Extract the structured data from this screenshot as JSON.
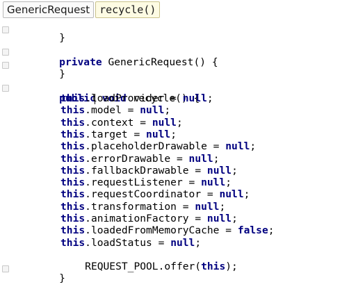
{
  "breadcrumb": {
    "class_name": "GenericRequest",
    "method_name": "recycle()"
  },
  "code": {
    "line_partial_top": "}",
    "ctor_private": "private",
    "ctor_name": " GenericRequest() {",
    "ctor_close": "}",
    "method_public": "public",
    "method_void": "void",
    "method_sig": " recycle() {",
    "assignments": [
      {
        "field": "loadProvider",
        "value": "null"
      },
      {
        "field": "model",
        "value": "null"
      },
      {
        "field": "context",
        "value": "null"
      },
      {
        "field": "target",
        "value": "null"
      },
      {
        "field": "placeholderDrawable",
        "value": "null"
      },
      {
        "field": "errorDrawable",
        "value": "null"
      },
      {
        "field": "fallbackDrawable",
        "value": "null"
      },
      {
        "field": "requestListener",
        "value": "null"
      },
      {
        "field": "requestCoordinator",
        "value": "null"
      },
      {
        "field": "transformation",
        "value": "null"
      },
      {
        "field": "animationFactory",
        "value": "null"
      },
      {
        "field": "loadedFromMemoryCache",
        "value": "false"
      },
      {
        "field": "loadStatus",
        "value": "null"
      }
    ],
    "this_kw": "this",
    "pool_call_prefix": "REQUEST_POOL.offer(",
    "pool_call_arg": "this",
    "pool_call_suffix": ");",
    "method_close": "}"
  },
  "colors": {
    "keyword": "#000080",
    "text": "#000000"
  }
}
